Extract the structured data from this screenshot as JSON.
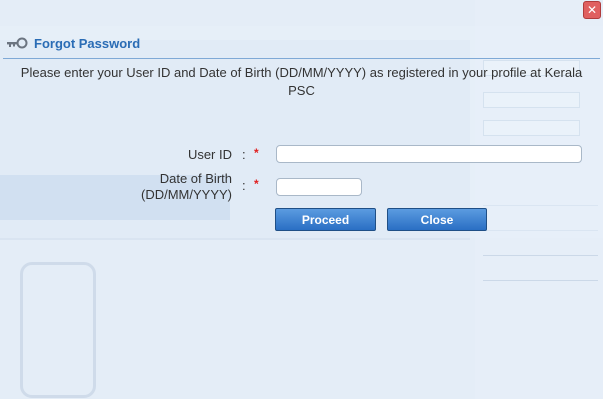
{
  "window": {
    "close_glyph": "✕"
  },
  "dialog": {
    "title": "Forgot Password",
    "message": "Please enter your User ID and Date of Birth (DD/MM/YYYY) as registered in your profile at Kerala PSC"
  },
  "form": {
    "user_id_label": "User ID",
    "dob_label_line1": "Date of Birth",
    "dob_label_line2": "(DD/MM/YYYY)",
    "colon": ":",
    "required_mark": "*",
    "user_id_value": "",
    "dob_value": ""
  },
  "buttons": {
    "proceed": "Proceed",
    "close": "Close"
  },
  "colors": {
    "title": "#2a6cb5",
    "button": "#2a6fc4",
    "required": "#e02020"
  },
  "icons": {
    "title_icon": "key-icon",
    "window_close": "close-icon"
  }
}
